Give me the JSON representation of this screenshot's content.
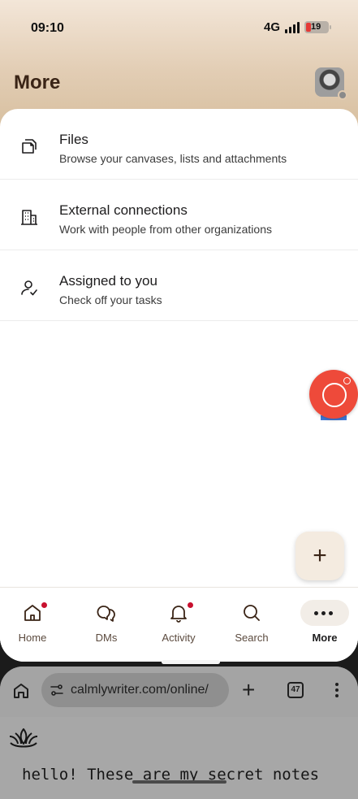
{
  "status_bar": {
    "time": "09:10",
    "network": "4G",
    "battery": "19"
  },
  "header": {
    "title": "More"
  },
  "menu": [
    {
      "title": "Files",
      "subtitle": "Browse your canvases, lists and attachments",
      "icon": "files-icon"
    },
    {
      "title": "External connections",
      "subtitle": "Work with people from other organizations",
      "icon": "building-icon"
    },
    {
      "title": "Assigned to you",
      "subtitle": "Check off your tasks",
      "icon": "person-check-icon"
    }
  ],
  "fab": {
    "label": "+"
  },
  "tabs": [
    {
      "label": "Home",
      "icon": "home-icon",
      "badge": true
    },
    {
      "label": "DMs",
      "icon": "dms-icon",
      "badge": false
    },
    {
      "label": "Activity",
      "icon": "bell-icon",
      "badge": true
    },
    {
      "label": "Search",
      "icon": "search-icon",
      "badge": false
    },
    {
      "label": "More",
      "icon": "more-icon",
      "badge": false,
      "active": true
    }
  ],
  "browser": {
    "url": "calmlywriter.com/online/",
    "tab_count": "47",
    "new_tab_label": "+",
    "content_text": "hello! These are my secret notes"
  },
  "colors": {
    "accent_red": "#ee4a3a",
    "header_brown": "#3a2416",
    "badge": "#c8102e"
  }
}
